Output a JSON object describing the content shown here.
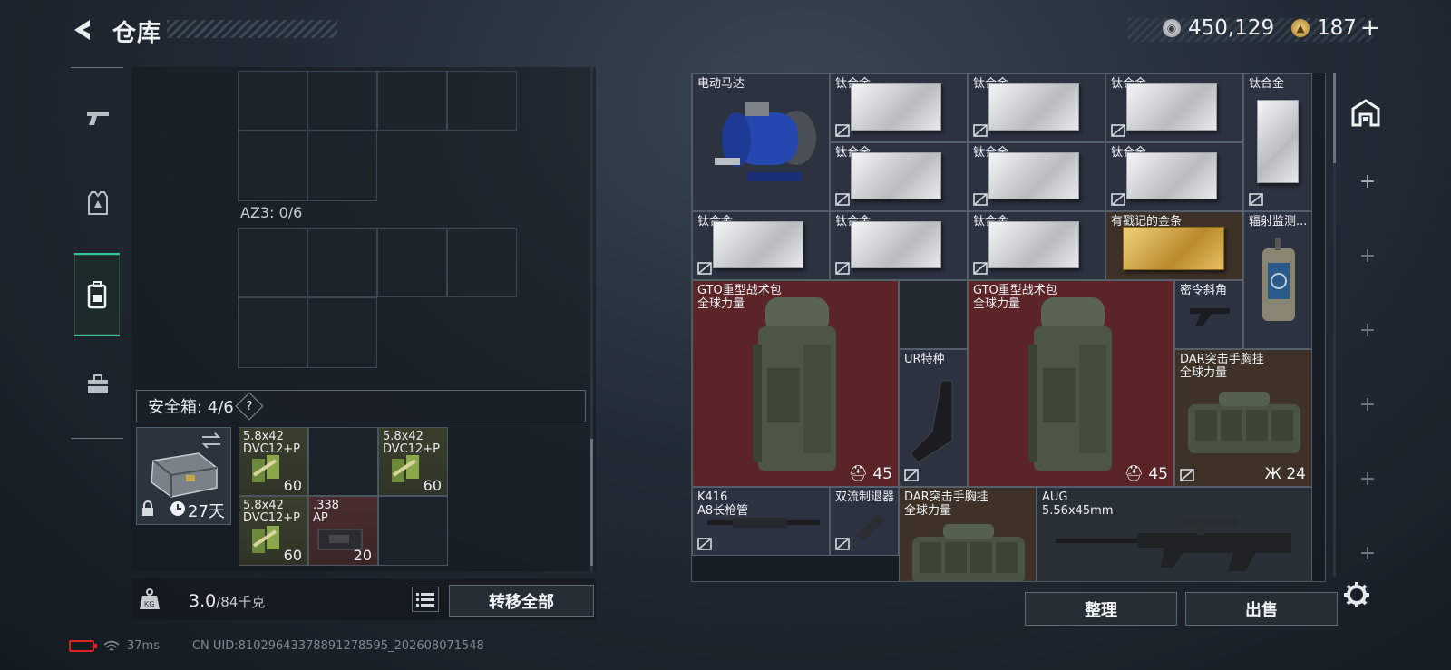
{
  "header": {
    "title": "仓库",
    "silver": "450,129",
    "gold": "187",
    "add_label": "+"
  },
  "nav": {
    "items": [
      "weapons",
      "armor",
      "backpack",
      "tools"
    ],
    "active": "backpack"
  },
  "left": {
    "az3_label": "AZ3: 0/6",
    "safe_label": "安全箱: 4/6",
    "safe_help": "?",
    "case_timer": "27天",
    "ammo": [
      {
        "name": "5.8x42\nDVC12+P",
        "count": "60"
      },
      {
        "name": "5.8x42\nDVC12+P",
        "count": "60"
      },
      {
        "name": "5.8x42\nDVC12+P",
        "count": "60"
      },
      {
        "name": ".338\nAP",
        "count": "20"
      }
    ],
    "weight_value": "3.0",
    "weight_max": "/84千克",
    "transfer_label": "转移全部"
  },
  "grid": {
    "motor": "电动马达",
    "titanium": "钛合金",
    "gold_bar": "有戳记的金条",
    "radiation": "辐射监测...",
    "backpack1": "GTO重型战术包\n全球力量",
    "backpack1_badge": "45",
    "backpack2": "GTO重型战术包\n全球力量",
    "backpack2_badge": "45",
    "stock": "UR特种",
    "grip": "密令斜角",
    "chest1": "DAR突击手胸挂\n全球力量",
    "chest1_badge": "24",
    "k416": "K416\nA8长枪管",
    "muzzle": "双流制退器",
    "chest2": "DAR突击手胸挂\n全球力量",
    "aug": "AUG\n5.56x45mm"
  },
  "buttons": {
    "sort": "整理",
    "sell": "出售"
  },
  "status": {
    "ping": "37ms",
    "uid": "CN UID:8102964337889127859​5_202608071548"
  }
}
